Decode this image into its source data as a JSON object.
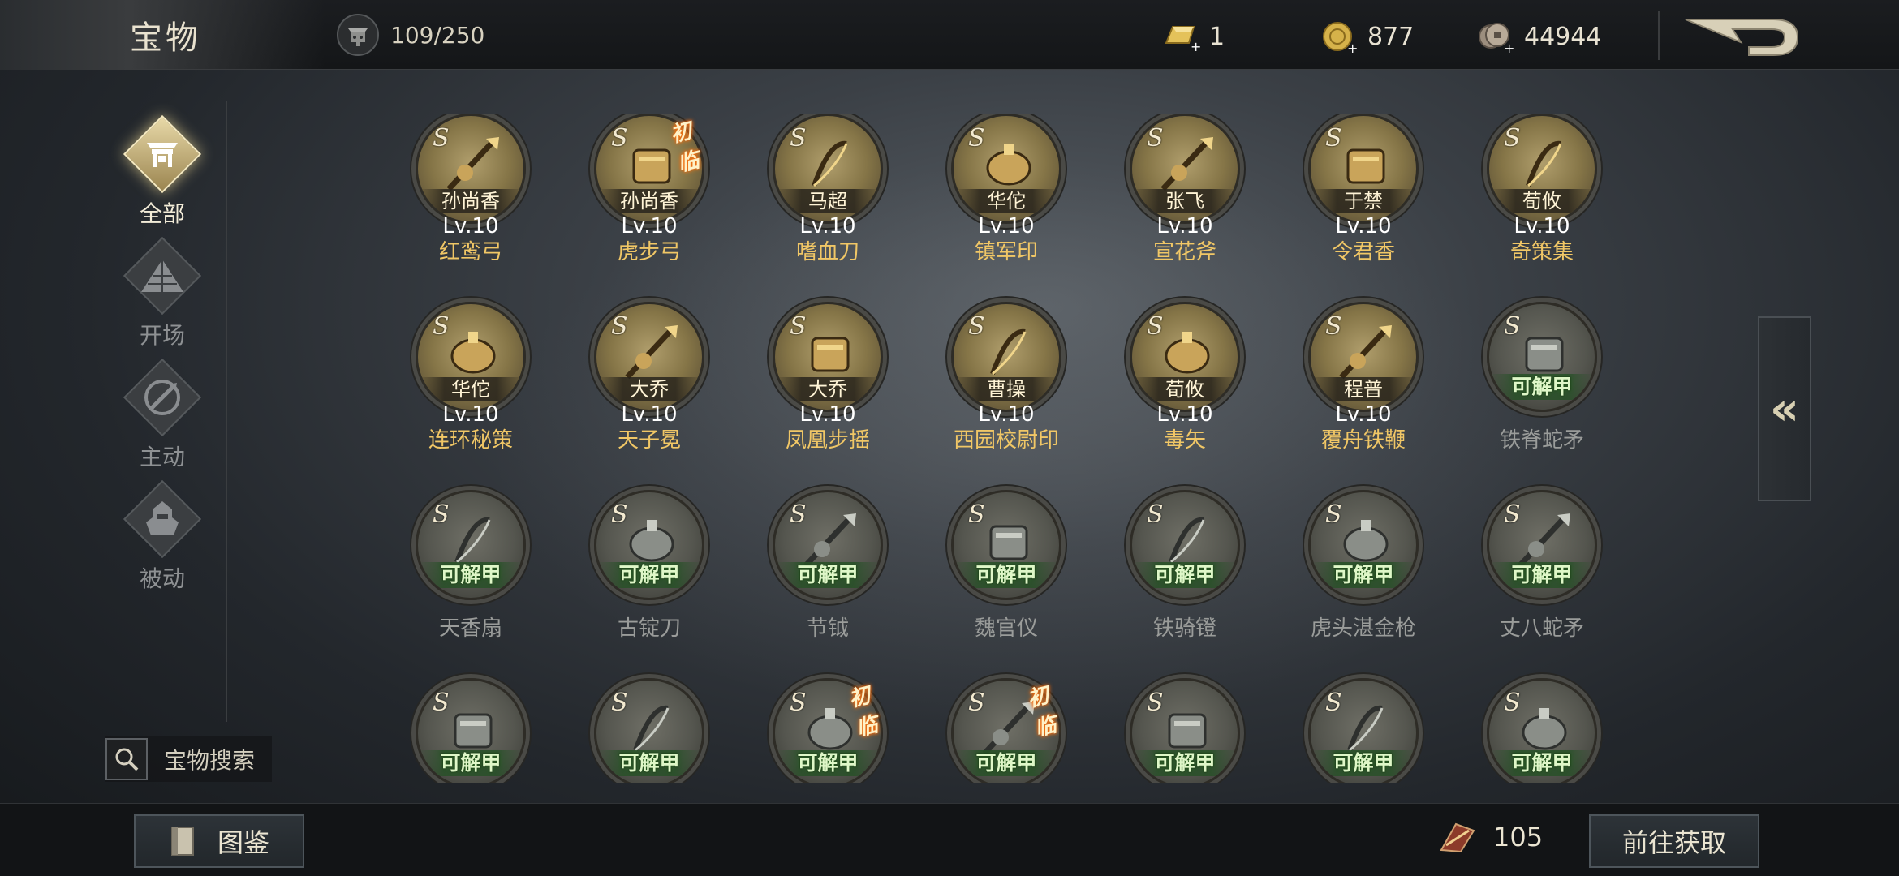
{
  "header": {
    "title": "宝物",
    "capacity": "109/250",
    "currencies": [
      {
        "icon": "gold-bar-icon",
        "value": "1"
      },
      {
        "icon": "gold-coin-icon",
        "value": "877"
      },
      {
        "icon": "silver-coin-icon",
        "value": "44944"
      }
    ]
  },
  "sidebar": {
    "categories": [
      {
        "label": "全部",
        "icon": "all-icon",
        "active": true
      },
      {
        "label": "开场",
        "icon": "pyramid-icon",
        "active": false
      },
      {
        "label": "主动",
        "icon": "active-skill-icon",
        "active": false
      },
      {
        "label": "被动",
        "icon": "passive-skill-icon",
        "active": false
      }
    ],
    "search_label": "宝物搜索"
  },
  "grade": "S",
  "new_tag": "初临",
  "unlock_label": "可解甲",
  "treasures": [
    {
      "owner": "孙尚香",
      "level": "Lv.10",
      "name": "红鸾弓",
      "locked": false,
      "new": false
    },
    {
      "owner": "孙尚香",
      "level": "Lv.10",
      "name": "虎步弓",
      "locked": false,
      "new": true
    },
    {
      "owner": "马超",
      "level": "Lv.10",
      "name": "嗜血刀",
      "locked": false,
      "new": false
    },
    {
      "owner": "华佗",
      "level": "Lv.10",
      "name": "镇军印",
      "locked": false,
      "new": false
    },
    {
      "owner": "张飞",
      "level": "Lv.10",
      "name": "宣花斧",
      "locked": false,
      "new": false
    },
    {
      "owner": "于禁",
      "level": "Lv.10",
      "name": "令君香",
      "locked": false,
      "new": false
    },
    {
      "owner": "荀攸",
      "level": "Lv.10",
      "name": "奇策集",
      "locked": false,
      "new": false
    },
    {
      "owner": "华佗",
      "level": "Lv.10",
      "name": "连环秘策",
      "locked": false,
      "new": false
    },
    {
      "owner": "大乔",
      "level": "Lv.10",
      "name": "天子冕",
      "locked": false,
      "new": false
    },
    {
      "owner": "大乔",
      "level": "Lv.10",
      "name": "凤凰步摇",
      "locked": false,
      "new": false
    },
    {
      "owner": "曹操",
      "level": "Lv.10",
      "name": "西园校尉印",
      "locked": false,
      "new": false
    },
    {
      "owner": "荀攸",
      "level": "Lv.10",
      "name": "毒矢",
      "locked": false,
      "new": false
    },
    {
      "owner": "程普",
      "level": "Lv.10",
      "name": "覆舟铁鞭",
      "locked": false,
      "new": false
    },
    {
      "owner": "",
      "level": "",
      "name": "铁脊蛇矛",
      "locked": true,
      "new": false
    },
    {
      "owner": "",
      "level": "",
      "name": "天香扇",
      "locked": true,
      "new": false
    },
    {
      "owner": "",
      "level": "",
      "name": "古锭刀",
      "locked": true,
      "new": false
    },
    {
      "owner": "",
      "level": "",
      "name": "节钺",
      "locked": true,
      "new": false
    },
    {
      "owner": "",
      "level": "",
      "name": "魏官仪",
      "locked": true,
      "new": false
    },
    {
      "owner": "",
      "level": "",
      "name": "铁骑镫",
      "locked": true,
      "new": false
    },
    {
      "owner": "",
      "level": "",
      "name": "虎头湛金枪",
      "locked": true,
      "new": false
    },
    {
      "owner": "",
      "level": "",
      "name": "丈八蛇矛",
      "locked": true,
      "new": false
    },
    {
      "owner": "",
      "level": "",
      "name": "",
      "locked": true,
      "new": false
    },
    {
      "owner": "",
      "level": "",
      "name": "",
      "locked": true,
      "new": false
    },
    {
      "owner": "",
      "level": "",
      "name": "",
      "locked": true,
      "new": true
    },
    {
      "owner": "",
      "level": "",
      "name": "",
      "locked": true,
      "new": true
    },
    {
      "owner": "",
      "level": "",
      "name": "",
      "locked": true,
      "new": false
    },
    {
      "owner": "",
      "level": "",
      "name": "",
      "locked": true,
      "new": false
    },
    {
      "owner": "",
      "level": "",
      "name": "",
      "locked": true,
      "new": false
    }
  ],
  "footer": {
    "catalog_label": "图鉴",
    "fragments": "105",
    "goto_label": "前往获取"
  }
}
